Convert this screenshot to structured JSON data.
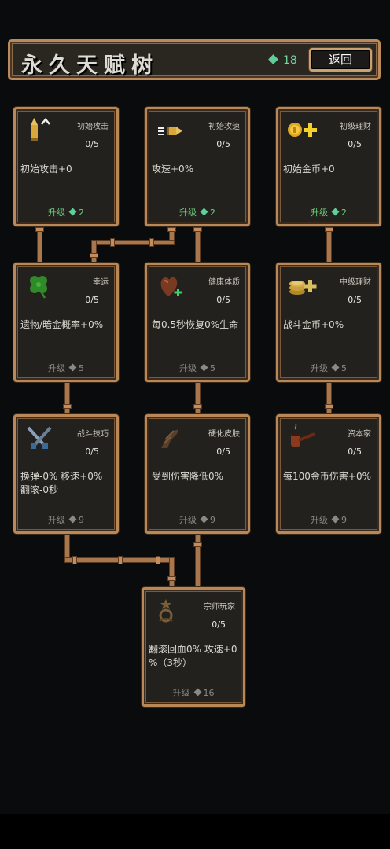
{
  "header": {
    "title": "永久天赋树",
    "gem_count": "18",
    "back_label": "返回"
  },
  "colors": {
    "accent_gem": "#5fcf9a",
    "frame": "#b88858",
    "upgrade_active": "#6fd07a",
    "upgrade_locked": "#8a8a84"
  },
  "cards": {
    "r0c0": {
      "name": "初始攻击",
      "level": "0/5",
      "desc": "初始攻击+0",
      "upgrade": "升级",
      "cost": "2",
      "icon": "bullet-upgrade-icon",
      "active": true
    },
    "r0c1": {
      "name": "初始攻速",
      "level": "0/5",
      "desc": "攻速+0%",
      "upgrade": "升级",
      "cost": "2",
      "icon": "speed-bullet-icon",
      "active": true
    },
    "r0c2": {
      "name": "初级理财",
      "level": "0/5",
      "desc": "初始金币+0",
      "upgrade": "升级",
      "cost": "2",
      "icon": "coin-plus-icon",
      "active": true
    },
    "r1c0": {
      "name": "幸运",
      "level": "0/5",
      "desc": "遗物/暗金概率+0%",
      "upgrade": "升级",
      "cost": "5",
      "icon": "clover-icon",
      "active": false
    },
    "r1c1": {
      "name": "健康体质",
      "level": "0/5",
      "desc": "每0.5秒恢复0%生命",
      "upgrade": "升级",
      "cost": "5",
      "icon": "heart-plus-icon",
      "active": false
    },
    "r1c2": {
      "name": "中级理财",
      "level": "0/5",
      "desc": "战斗金币+0%",
      "upgrade": "升级",
      "cost": "5",
      "icon": "coin-stack-plus-icon",
      "active": false
    },
    "r2c0": {
      "name": "战斗技巧",
      "level": "0/5",
      "desc": "换弹-0% 移速+0%\n翻滚-0秒",
      "upgrade": "升级",
      "cost": "9",
      "icon": "crossed-daggers-icon",
      "active": false
    },
    "r2c1": {
      "name": "硬化皮肤",
      "level": "0/5",
      "desc": "受到伤害降低0%",
      "upgrade": "升级",
      "cost": "9",
      "icon": "hardened-arm-icon",
      "active": false
    },
    "r2c2": {
      "name": "资本家",
      "level": "0/5",
      "desc": "每100金币伤害+0%",
      "upgrade": "升级",
      "cost": "9",
      "icon": "pipe-icon",
      "active": false
    },
    "r3c0": {
      "name": "宗师玩家",
      "level": "0/5",
      "desc": "翻滚回血0% 攻速+0\n%（3秒）",
      "upgrade": "升级",
      "cost": "16",
      "icon": "medal-icon",
      "active": false
    }
  }
}
